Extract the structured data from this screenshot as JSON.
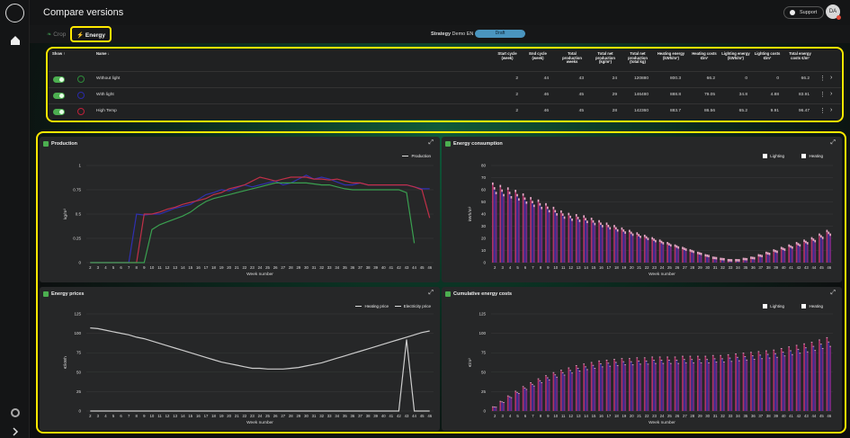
{
  "app": {
    "title": "Compare versions",
    "support_label": "Support",
    "avatar_initials": "DA"
  },
  "tabs": [
    {
      "label": "Crop"
    },
    {
      "label": "Energy"
    }
  ],
  "strategy": {
    "label": "Strategy",
    "value": "Demo EN",
    "status": "Draft"
  },
  "table": {
    "headers": {
      "show": "Show",
      "name": "Name",
      "start": "Start cycle (week)",
      "end": "End cycle (week)",
      "total_weeks": "Total production weeks",
      "net_kg_m2": "Total net production (kg/m²)",
      "net_kg": "Total net production (total kg)",
      "heat_e": "Heating energy (kWh/m²)",
      "heat_c": "Heating costs €/m²",
      "light_e": "Lighting energy (kWh/m²)",
      "light_c": "Lighting costs €/m²",
      "total_c": "Total energy costs €/m²"
    },
    "rows": [
      {
        "name": "Without light",
        "color": "#2e8b3a",
        "start": "2",
        "end": "44",
        "weeks": "43",
        "net": "24",
        "total": "120880",
        "heat_e": "800.3",
        "heat_c": "66.2",
        "light_e": "0",
        "light_c": "0",
        "cost": "66.2"
      },
      {
        "name": "With light",
        "color": "#2a2aa8",
        "start": "2",
        "end": "46",
        "weeks": "45",
        "net": "29",
        "total": "146480",
        "heat_e": "888.8",
        "heat_c": "79.05",
        "light_e": "34.8",
        "light_c": "4.88",
        "cost": "83.91"
      },
      {
        "name": "High Temp",
        "color": "#c0203a",
        "start": "2",
        "end": "46",
        "weeks": "45",
        "net": "28",
        "total": "142360",
        "heat_e": "883.7",
        "heat_c": "86.56",
        "light_e": "65.2",
        "light_c": "9.91",
        "cost": "96.47"
      }
    ]
  },
  "charts": {
    "production": {
      "title": "Production",
      "legend": "Production",
      "ylabel": "kg/m²",
      "xlabel": "Week number"
    },
    "consumption": {
      "title": "Energy consumption",
      "legend_a": "Lighting",
      "legend_b": "Heating",
      "ylabel": "kWh/m²",
      "xlabel": "Week number"
    },
    "prices": {
      "title": "Energy prices",
      "legend_a": "Heating price",
      "legend_b": "Electricity price",
      "ylabel": "€/kWh",
      "ylabel_right": "€/kWh",
      "xlabel": "Week number"
    },
    "cumulative": {
      "title": "Cumulative energy costs",
      "legend_a": "Lighting",
      "legend_b": "Heating",
      "ylabel": "€/m²",
      "xlabel": "Week number"
    }
  },
  "chart_data": [
    {
      "type": "line",
      "title": "Production",
      "xlabel": "Week number",
      "ylabel": "kg/m²",
      "ylim": [
        0,
        1
      ],
      "yticks": [
        0,
        0.25,
        0.5,
        0.75,
        1
      ],
      "x": [
        2,
        3,
        4,
        5,
        6,
        7,
        8,
        9,
        10,
        11,
        12,
        13,
        14,
        15,
        16,
        17,
        18,
        19,
        20,
        21,
        22,
        23,
        24,
        25,
        26,
        27,
        28,
        29,
        30,
        31,
        32,
        33,
        34,
        35,
        36,
        37,
        38,
        39,
        40,
        41,
        42,
        43,
        44,
        45,
        46
      ],
      "series": [
        {
          "name": "With light",
          "color": "#3030b0",
          "values": [
            0,
            0,
            0,
            0,
            0,
            0,
            0.5,
            0.49,
            0.5,
            0.5,
            0.53,
            0.56,
            0.58,
            0.6,
            0.65,
            0.7,
            0.72,
            0.75,
            0.74,
            0.77,
            0.8,
            0.78,
            0.8,
            0.82,
            0.84,
            0.8,
            0.82,
            0.86,
            0.9,
            0.86,
            0.88,
            0.86,
            0.83,
            0.8,
            0.8,
            0.82,
            0.8,
            0.8,
            0.8,
            0.8,
            0.8,
            0.8,
            0.78,
            0.76,
            0.76
          ]
        },
        {
          "name": "High Temp",
          "color": "#c03048",
          "values": [
            0,
            0,
            0,
            0,
            0,
            0,
            0,
            0.5,
            0.5,
            0.52,
            0.55,
            0.57,
            0.6,
            0.62,
            0.64,
            0.66,
            0.7,
            0.72,
            0.76,
            0.78,
            0.8,
            0.84,
            0.88,
            0.86,
            0.84,
            0.86,
            0.88,
            0.88,
            0.88,
            0.86,
            0.86,
            0.85,
            0.86,
            0.84,
            0.82,
            0.82,
            0.8,
            0.8,
            0.8,
            0.8,
            0.8,
            0.8,
            0.78,
            0.75,
            0.46
          ]
        },
        {
          "name": "Without light",
          "color": "#3aa050",
          "values": [
            0,
            0,
            0,
            0,
            0,
            0,
            0,
            0,
            0.34,
            0.39,
            0.42,
            0.45,
            0.48,
            0.52,
            0.58,
            0.63,
            0.66,
            0.68,
            0.7,
            0.72,
            0.74,
            0.76,
            0.78,
            0.8,
            0.82,
            0.82,
            0.82,
            0.82,
            0.82,
            0.81,
            0.8,
            0.8,
            0.78,
            0.76,
            0.75,
            0.75,
            0.75,
            0.75,
            0.75,
            0.75,
            0.75,
            0.72,
            0.2
          ]
        }
      ]
    },
    {
      "type": "bar",
      "title": "Energy consumption",
      "xlabel": "Week number",
      "ylabel": "kWh/m²",
      "ylim": [
        0,
        80
      ],
      "yticks": [
        0,
        10,
        20,
        30,
        40,
        50,
        60,
        70,
        80
      ],
      "x": [
        2,
        3,
        4,
        5,
        6,
        7,
        8,
        9,
        10,
        11,
        12,
        13,
        14,
        15,
        16,
        17,
        18,
        19,
        20,
        21,
        22,
        23,
        24,
        25,
        26,
        27,
        28,
        29,
        30,
        31,
        32,
        33,
        34,
        35,
        36,
        37,
        38,
        39,
        40,
        41,
        42,
        43,
        44,
        45,
        46
      ],
      "series": [
        {
          "name": "Heating",
          "values": [
            64,
            62,
            60,
            58,
            55,
            52,
            50,
            47,
            44,
            41,
            39,
            38,
            37,
            35,
            33,
            31,
            29,
            27,
            25,
            23,
            21,
            19,
            17,
            15,
            13,
            11,
            9,
            7,
            5,
            3,
            2,
            1,
            1,
            2,
            3,
            5,
            7,
            9,
            11,
            13,
            15,
            17,
            19,
            22,
            25
          ]
        },
        {
          "name": "Lighting",
          "values": [
            2,
            2,
            2,
            2,
            2,
            2,
            2,
            2,
            2,
            2,
            2,
            2,
            2,
            2,
            2,
            2,
            2,
            2,
            2,
            2,
            2,
            2,
            2,
            2,
            2,
            2,
            2,
            2,
            2,
            2,
            2,
            2,
            2,
            2,
            2,
            2,
            2,
            2,
            2,
            2,
            2,
            2,
            2,
            2,
            2
          ]
        }
      ]
    },
    {
      "type": "line",
      "title": "Energy prices",
      "xlabel": "Week number",
      "ylabel": "€/kWh",
      "ylim": [
        0,
        125
      ],
      "yticks": [
        0,
        25,
        50,
        75,
        100,
        125
      ],
      "x": [
        2,
        3,
        4,
        5,
        6,
        7,
        8,
        9,
        10,
        11,
        12,
        13,
        14,
        15,
        16,
        17,
        18,
        19,
        20,
        21,
        22,
        23,
        24,
        25,
        26,
        27,
        28,
        29,
        30,
        31,
        32,
        33,
        34,
        35,
        36,
        37,
        38,
        39,
        40,
        41,
        42,
        43,
        44,
        45,
        46
      ],
      "series": [
        {
          "name": "Heating price",
          "values": [
            107,
            106,
            104,
            102,
            100,
            98,
            95,
            93,
            90,
            87,
            84,
            81,
            78,
            75,
            72,
            69,
            66,
            63,
            61,
            59,
            57,
            55,
            55,
            54,
            54,
            54,
            55,
            56,
            58,
            60,
            62,
            65,
            68,
            71,
            74,
            77,
            80,
            83,
            86,
            89,
            92,
            95,
            98,
            101,
            103
          ]
        },
        {
          "name": "Electricity price",
          "values": [
            0,
            0,
            0,
            0,
            0,
            0,
            0,
            0,
            0,
            0,
            0,
            0,
            0,
            0,
            0,
            0,
            0,
            0,
            0,
            0,
            0,
            0,
            0,
            0,
            0,
            0,
            0,
            0,
            0,
            0,
            0,
            0,
            0,
            0,
            0,
            0,
            0,
            0,
            0,
            0,
            0,
            92,
            0,
            0,
            0
          ]
        }
      ]
    },
    {
      "type": "bar",
      "title": "Cumulative energy costs",
      "xlabel": "Week number",
      "ylabel": "€/m²",
      "ylim": [
        0,
        125
      ],
      "yticks": [
        0,
        25,
        50,
        75,
        100,
        125
      ],
      "x": [
        2,
        3,
        4,
        5,
        6,
        7,
        8,
        9,
        10,
        11,
        12,
        13,
        14,
        15,
        16,
        17,
        18,
        19,
        20,
        21,
        22,
        23,
        24,
        25,
        26,
        27,
        28,
        29,
        30,
        31,
        32,
        33,
        34,
        35,
        36,
        37,
        38,
        39,
        40,
        41,
        42,
        43,
        44,
        45,
        46
      ],
      "series": [
        {
          "name": "Heating",
          "values": [
            5,
            12,
            19,
            25,
            31,
            36,
            41,
            45,
            49,
            52,
            55,
            58,
            60,
            62,
            64,
            65,
            66,
            67,
            67,
            68,
            68,
            69,
            69,
            69,
            69,
            70,
            70,
            70,
            70,
            71,
            71,
            72,
            73,
            74,
            75,
            76,
            77,
            78,
            80,
            82,
            84,
            86,
            88,
            91,
            94
          ]
        },
        {
          "name": "Lighting",
          "values": [
            1,
            1,
            1,
            1,
            1,
            1,
            1,
            1,
            1,
            1,
            1,
            1,
            1,
            1,
            1,
            1,
            1,
            1,
            1,
            1,
            1,
            1,
            1,
            1,
            1,
            1,
            1,
            1,
            1,
            1,
            1,
            1,
            1,
            1,
            1,
            1,
            1,
            1,
            1,
            1,
            1,
            1,
            1,
            1,
            1
          ]
        }
      ]
    }
  ]
}
